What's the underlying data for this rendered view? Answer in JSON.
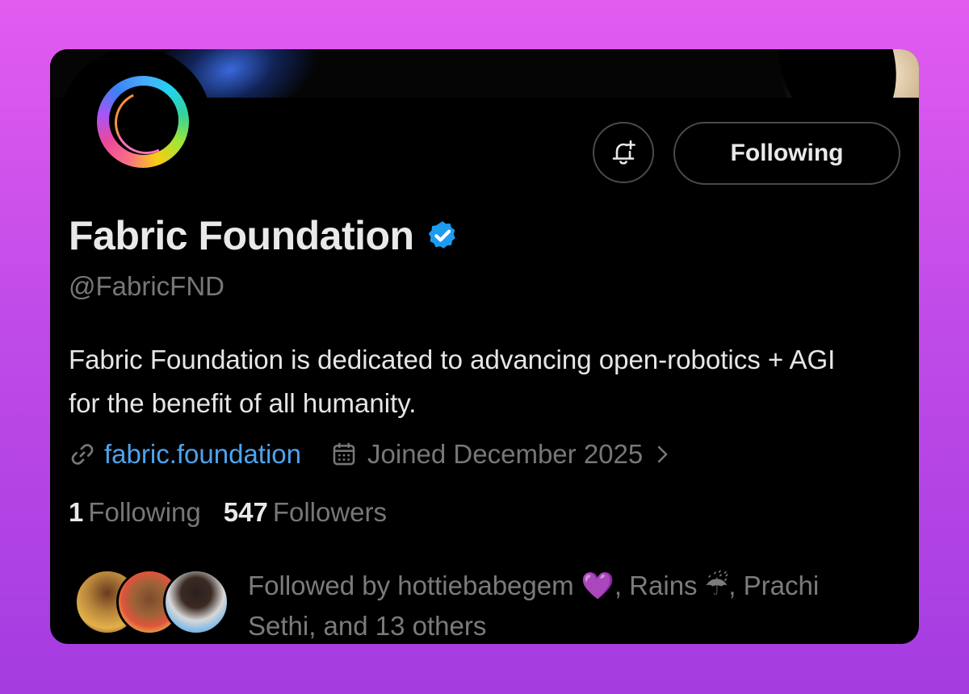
{
  "profile": {
    "display_name": "Fabric Foundation",
    "verified": true,
    "handle": "@FabricFND",
    "bio": "Fabric Foundation is dedicated to advancing open-robotics + AGI for the benefit of all humanity.",
    "website": "fabric.foundation",
    "joined": "Joined December 2025"
  },
  "actions": {
    "follow_label": "Following",
    "notify_icon": "bell-plus-icon"
  },
  "stats": {
    "following_count": "1",
    "following_label": "Following",
    "followers_count": "547",
    "followers_label": "Followers"
  },
  "followed_by": {
    "text": "Followed by hottiebabegem 💜, Rains ☔, Prachi Sethi, and 13 others"
  },
  "colors": {
    "background_top": "#e25cf0",
    "background_bottom": "#a43ce0",
    "card": "#000000",
    "link": "#4ea3ee",
    "verified_badge": "#1d9bf0",
    "muted_text": "#777777"
  }
}
